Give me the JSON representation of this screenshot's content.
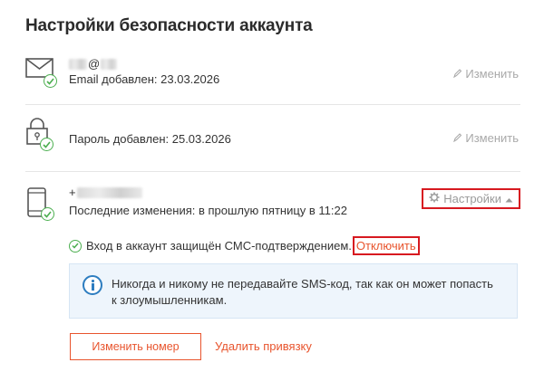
{
  "page": {
    "title": "Настройки безопасности аккаунта"
  },
  "email_row": {
    "masked_prefix_visible": "@",
    "added_text": "Email добавлен: 23.03.2026",
    "edit_label": "Изменить"
  },
  "password_row": {
    "added_text": "Пароль добавлен: 25.03.2026",
    "edit_label": "Изменить"
  },
  "phone_row": {
    "masked_prefix_visible": "+",
    "last_changes_text": "Последние изменения: в прошлую пятницу в 11:22",
    "settings_label": "Настройки",
    "sms_protection_text": "Вход в аккаунт защищён СМС-подтверждением.",
    "disable_label": "Отключить",
    "info_text": "Никогда и никому не передавайте SMS-код, так как он может попасть к злоумышленникам.",
    "change_number_label": "Изменить номер",
    "remove_binding_label": "Удалить привязку"
  },
  "colors": {
    "accent": "#e8542d",
    "highlight_border": "#d71920",
    "success": "#4caf50",
    "info": "#2d7dc0",
    "muted": "#a9a9a9"
  }
}
